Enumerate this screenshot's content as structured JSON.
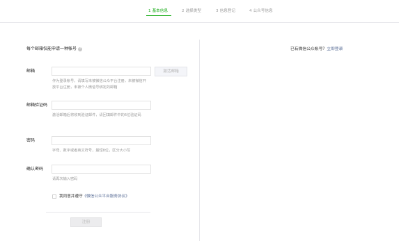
{
  "steps": [
    {
      "num": "1",
      "label": "基本信息"
    },
    {
      "num": "2",
      "label": "选择类型"
    },
    {
      "num": "3",
      "label": "信息登记"
    },
    {
      "num": "4",
      "label": "公众号信息"
    }
  ],
  "colors": {
    "accent": "#1aad19",
    "link": "#576b95",
    "muted": "#9a9a9a"
  },
  "form": {
    "intro": "每个邮箱仅能申请一种帐号",
    "help_icon": "question-circle-icon",
    "email": {
      "label": "邮箱",
      "value": "",
      "activate_button": "激活邮箱",
      "hint": "作为登录帐号，请填写未被微信公众平台注册，未被微信开放平台注册，未被个人微信号绑定的邮箱"
    },
    "verify_code": {
      "label": "邮箱验证码",
      "value": "",
      "hint": "激活邮箱后将收到验证邮件，请回填邮件中的6位验证码"
    },
    "password": {
      "label": "密码",
      "value": "",
      "hint": "字母、数字或者英文符号，最短8位，区分大小写"
    },
    "confirm_password": {
      "label": "确认密码",
      "value": "",
      "hint": "请再次输入密码"
    },
    "agree": {
      "prefix": "我同意并遵守",
      "link": "《微信公众平台服务协议》"
    },
    "register_button": "注册"
  },
  "side": {
    "question": "已有微信公众帐号？",
    "login_link": "立即登录"
  }
}
